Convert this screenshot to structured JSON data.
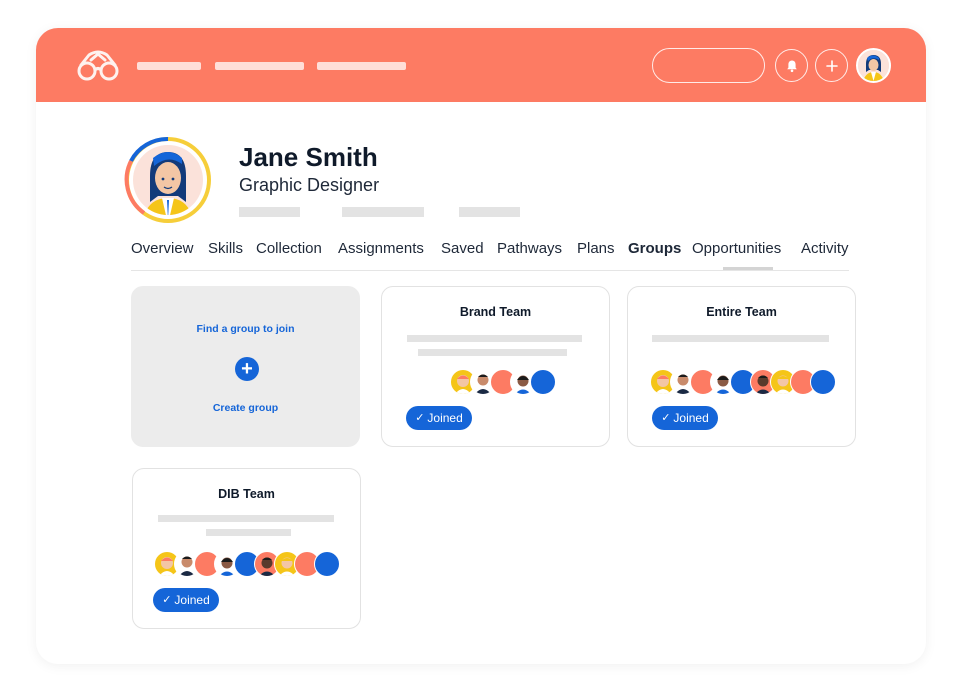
{
  "colors": {
    "brand": "#fd7b63",
    "accent": "#1565d8",
    "coral": "#fd7b63"
  },
  "header": {
    "logo_icon": "glasses-icon",
    "notification_icon": "bell-icon",
    "add_icon": "plus-icon"
  },
  "profile": {
    "name": "Jane Smith",
    "role": "Graphic Designer"
  },
  "tabs": [
    "Overview",
    "Skills",
    "Collection",
    "Assignments",
    "Saved",
    "Pathways",
    "Plans",
    "Groups",
    "Opportunities",
    "Activity"
  ],
  "active_tab": "Groups",
  "find_card": {
    "find_label": "Find a group to join",
    "create_label": "Create group"
  },
  "groups": [
    {
      "name": "Brand Team",
      "status": "Joined"
    },
    {
      "name": "Entire Team",
      "status": "Joined"
    },
    {
      "name": "DIB Team",
      "status": "Joined"
    }
  ]
}
